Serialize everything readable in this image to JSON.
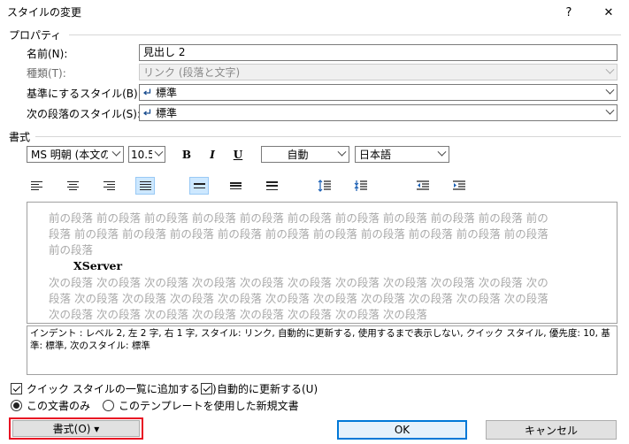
{
  "window": {
    "title": "スタイルの変更",
    "help_label": "?",
    "close_label": "✕"
  },
  "properties": {
    "section_label": "プロパティ",
    "name_label": "名前(N):",
    "name_value": "見出し 2",
    "type_label": "種類(T):",
    "type_value": "リンク (段落と文字)",
    "based_on_label": "基準にするスタイル(B):",
    "based_on_value": "標準",
    "next_label": "次の段落のスタイル(S):",
    "next_value": "標準"
  },
  "formatting": {
    "section_label": "書式",
    "font_value": "MS 明朝 (本文の",
    "size_value": "10.5",
    "bold_label": "B",
    "italic_label": "I",
    "underline_label": "U",
    "color_value": "自動",
    "language_value": "日本語"
  },
  "preview": {
    "prev_line1": "前の段落 前の段落 前の段落 前の段落 前の段落 前の段落 前の段落 前の段落 前の段落 前の段落 前の",
    "prev_line2": "段落 前の段落 前の段落 前の段落 前の段落 前の段落 前の段落 前の段落 前の段落 前の段落 前の段落",
    "prev_line3": "前の段落",
    "sample_text": "XServer",
    "next_line1": "次の段落 次の段落 次の段落 次の段落 次の段落 次の段落 次の段落 次の段落 次の段落 次の段落 次の",
    "next_line2": "段落 次の段落 次の段落 次の段落 次の段落 次の段落 次の段落 次の段落 次の段落 次の段落 次の段落",
    "next_line3": "次の段落 次の段落 次の段落 次の段落 次の段落 次の段落 次の段落 次の段落"
  },
  "description": "インデント : レベル 2, 左   2 字, 右   1 字, スタイル: リンク, 自動的に更新する, 使用するまで表示しない, クイック スタイル, 優先度: 10, 基準: 標準, 次のスタイル: 標準",
  "options": {
    "add_quick_style_label": "クイック スタイルの一覧に追加する(Q)",
    "add_quick_style_checked": true,
    "auto_update_label": "自動的に更新する(U)",
    "auto_update_checked": true,
    "this_document_label": "この文書のみ",
    "template_label": "このテンプレートを使用した新規文書",
    "selected_scope": "this_document"
  },
  "buttons": {
    "format_label": "書式(O) ▾",
    "ok_label": "OK",
    "cancel_label": "キャンセル"
  },
  "colors": {
    "highlight_red": "#e81123",
    "selected_blue": "#cde8ff",
    "primary_border": "#0078d7"
  }
}
